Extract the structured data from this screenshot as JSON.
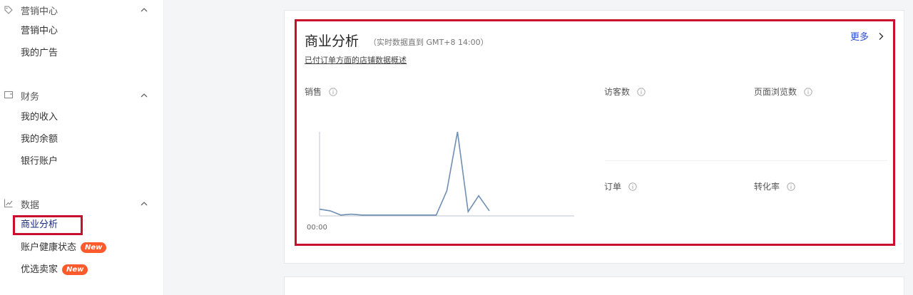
{
  "sidebar": {
    "sections": [
      {
        "title": "营销中心",
        "icon": "tag-icon",
        "items": [
          {
            "label": "营销中心"
          },
          {
            "label": "我的广告"
          }
        ]
      },
      {
        "title": "财务",
        "icon": "wallet-icon",
        "items": [
          {
            "label": "我的收入"
          },
          {
            "label": "我的余额"
          },
          {
            "label": "银行账户"
          }
        ]
      },
      {
        "title": "数据",
        "icon": "line-chart-icon",
        "items": [
          {
            "label": "商业分析",
            "active": true
          },
          {
            "label": "账户健康状态",
            "badge": "New"
          },
          {
            "label": "优选卖家",
            "badge": "New"
          }
        ]
      }
    ]
  },
  "business": {
    "title": "商业分析",
    "subtitle": "（实时数据直到 GMT+8 14:00）",
    "more_label": "更多",
    "overview_link": "已付订单方面的店铺数据概述",
    "metrics": {
      "sales": "销售",
      "visitors": "访客数",
      "page_views": "页面浏览数",
      "orders": "订单",
      "conversion": "转化率"
    }
  },
  "chart_data": {
    "type": "line",
    "title": "",
    "xlabel": "",
    "ylabel": "",
    "x_start_label": "00:00",
    "x": [
      0,
      1,
      2,
      3,
      4,
      5,
      6,
      7,
      8,
      9,
      10,
      11,
      12,
      13,
      14
    ],
    "series": [
      {
        "values": [
          8,
          6,
          1,
          2,
          1,
          1,
          1,
          1,
          1,
          1,
          1,
          1,
          30,
          100,
          5,
          24,
          6
        ]
      }
    ],
    "ylim": [
      0,
      100
    ],
    "grid": false,
    "colors": {
      "line": "#6f8fb3",
      "axis": "#bcc3cc"
    }
  }
}
